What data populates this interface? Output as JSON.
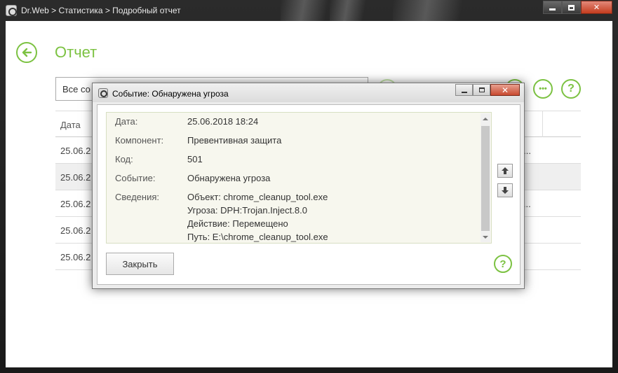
{
  "window": {
    "title": "Dr.Web > Статистика > Подробный отчет",
    "close_glyph": "✕"
  },
  "page": {
    "title": "Отчет",
    "filter_value": "Все со",
    "column_header": "Дата",
    "help_glyph": "?",
    "more_glyph": "•••",
    "rows": [
      {
        "date": "25.06.2",
        "tail": "н..."
      },
      {
        "date": "25.06.2",
        "tail": ""
      },
      {
        "date": "25.06.2",
        "tail": "в..."
      },
      {
        "date": "25.06.2",
        "tail": ""
      },
      {
        "date": "25.06.2",
        "tail": ""
      }
    ]
  },
  "dialog": {
    "title": "Событие: Обнаружена угроза",
    "close_glyph": "✕",
    "fields": {
      "date_label": "Дата:",
      "date_value": "25.06.2018 18:24",
      "component_label": "Компонент:",
      "component_value": "Превентивная защита",
      "code_label": "Код:",
      "code_value": "501",
      "event_label": "Событие:",
      "event_value": "Обнаружена угроза",
      "details_label": "Сведения:",
      "details_lines": [
        "Объект: chrome_cleanup_tool.exe",
        "Угроза: DPH:Trojan.Inject.8.0",
        "Действие: Перемещено",
        "Путь: E:\\chrome_cleanup_tool.exe"
      ]
    },
    "close_button": "Закрыть",
    "help_glyph": "?"
  },
  "colors": {
    "accent": "#7cc242",
    "frame": "#1f1f1f"
  }
}
